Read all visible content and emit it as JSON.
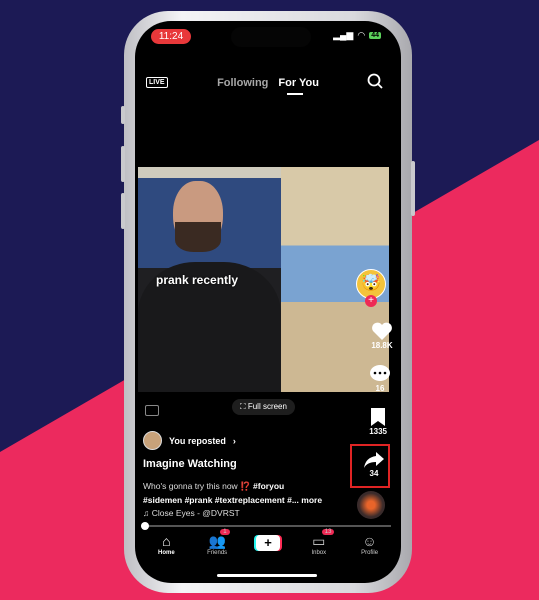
{
  "status": {
    "time": "11:24",
    "battery": "44"
  },
  "header": {
    "live": "LIVE",
    "tabs": [
      "Following",
      "For You"
    ],
    "active_tab": "For You"
  },
  "video": {
    "caption": "prank recently",
    "full_screen": "Full screen"
  },
  "actions": {
    "likes": "18.8K",
    "comments": "16",
    "saves": "1335",
    "shares": "34"
  },
  "post": {
    "repost": "You reposted",
    "title": "Imagine Watching",
    "description_plain": "Who's gonna try this now",
    "emoji": "⁉️",
    "tags_line1": "#foryou",
    "tags_line2": "#sidemen #prank #textreplacement #...",
    "more": "more",
    "music": "Close Eyes - @DVRST"
  },
  "nav": {
    "items": [
      {
        "label": "Home",
        "icon": "home-icon"
      },
      {
        "label": "Friends",
        "icon": "friends-icon",
        "badge": "1"
      },
      {
        "label": "",
        "icon": "plus-icon"
      },
      {
        "label": "Inbox",
        "icon": "inbox-icon",
        "badge": "13"
      },
      {
        "label": "Profile",
        "icon": "profile-icon"
      }
    ]
  },
  "colors": {
    "accent": "#ee2a55",
    "highlight": "#e02424",
    "bg_navy": "#1c1a55",
    "bg_pink": "#ec2a5e"
  }
}
